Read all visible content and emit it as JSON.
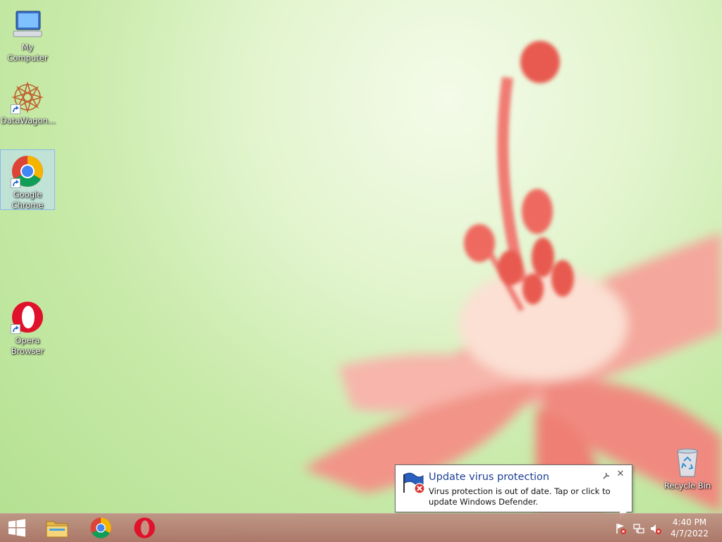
{
  "desktop": {
    "icons": [
      {
        "label": "My Computer",
        "icon": "computer-icon"
      },
      {
        "label": "DataWagon...",
        "icon": "datawagon-icon"
      },
      {
        "label": "Google Chrome",
        "icon": "chrome-icon",
        "selected": true
      },
      {
        "label": "Opera Browser",
        "icon": "opera-icon"
      },
      {
        "label": "Recycle Bin",
        "icon": "recycle-bin-icon"
      }
    ]
  },
  "taskbar": {
    "start": "windows-logo-icon",
    "pinned": [
      "file-explorer-icon",
      "chrome-icon",
      "opera-icon"
    ],
    "tray": [
      "action-center-alert-icon",
      "network-icon",
      "volume-muted-icon"
    ],
    "clock": {
      "time": "4:40 PM",
      "date": "4/7/2022"
    }
  },
  "notification": {
    "title": "Update virus protection",
    "message": "Virus protection is out of date. Tap or click to update Windows Defender.",
    "icon": "defender-flag-error-icon"
  },
  "colors": {
    "notification_title": "#1c3f94",
    "taskbar": "#b07a70"
  }
}
